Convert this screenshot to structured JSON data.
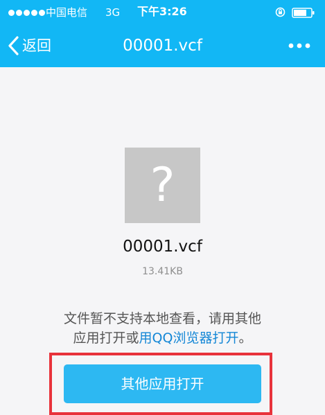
{
  "status_bar": {
    "carrier": "中国电信",
    "network": "3G",
    "time": "下午3:26",
    "battery_level": 0.75,
    "signal_bars": 5,
    "colors": {
      "background": "#12b7f5",
      "foreground": "#ffffff"
    },
    "icons": [
      "signal-dots-icon",
      "lock-rotation-icon",
      "battery-icon"
    ]
  },
  "nav": {
    "back_label": "返回",
    "title": "00001.vcf",
    "back_icon": "chevron-left-icon",
    "more_icon": "more-dots-icon"
  },
  "file": {
    "icon": "unknown-file-icon",
    "icon_glyph": "?",
    "name": "00001.vcf",
    "size": "13.41KB"
  },
  "notice": {
    "line1": "文件暂不支持本地查看，请用其他",
    "line2_prefix": "应用打开或",
    "line2_link": "用QQ浏览器打开",
    "line2_suffix": "。"
  },
  "actions": {
    "open_other_label": "其他应用打开"
  },
  "colors": {
    "accent": "#12b7f5",
    "button": "#2db8f2",
    "link": "#1487d6",
    "highlight": "#e8323b",
    "page_background": "#f5f5f7"
  }
}
